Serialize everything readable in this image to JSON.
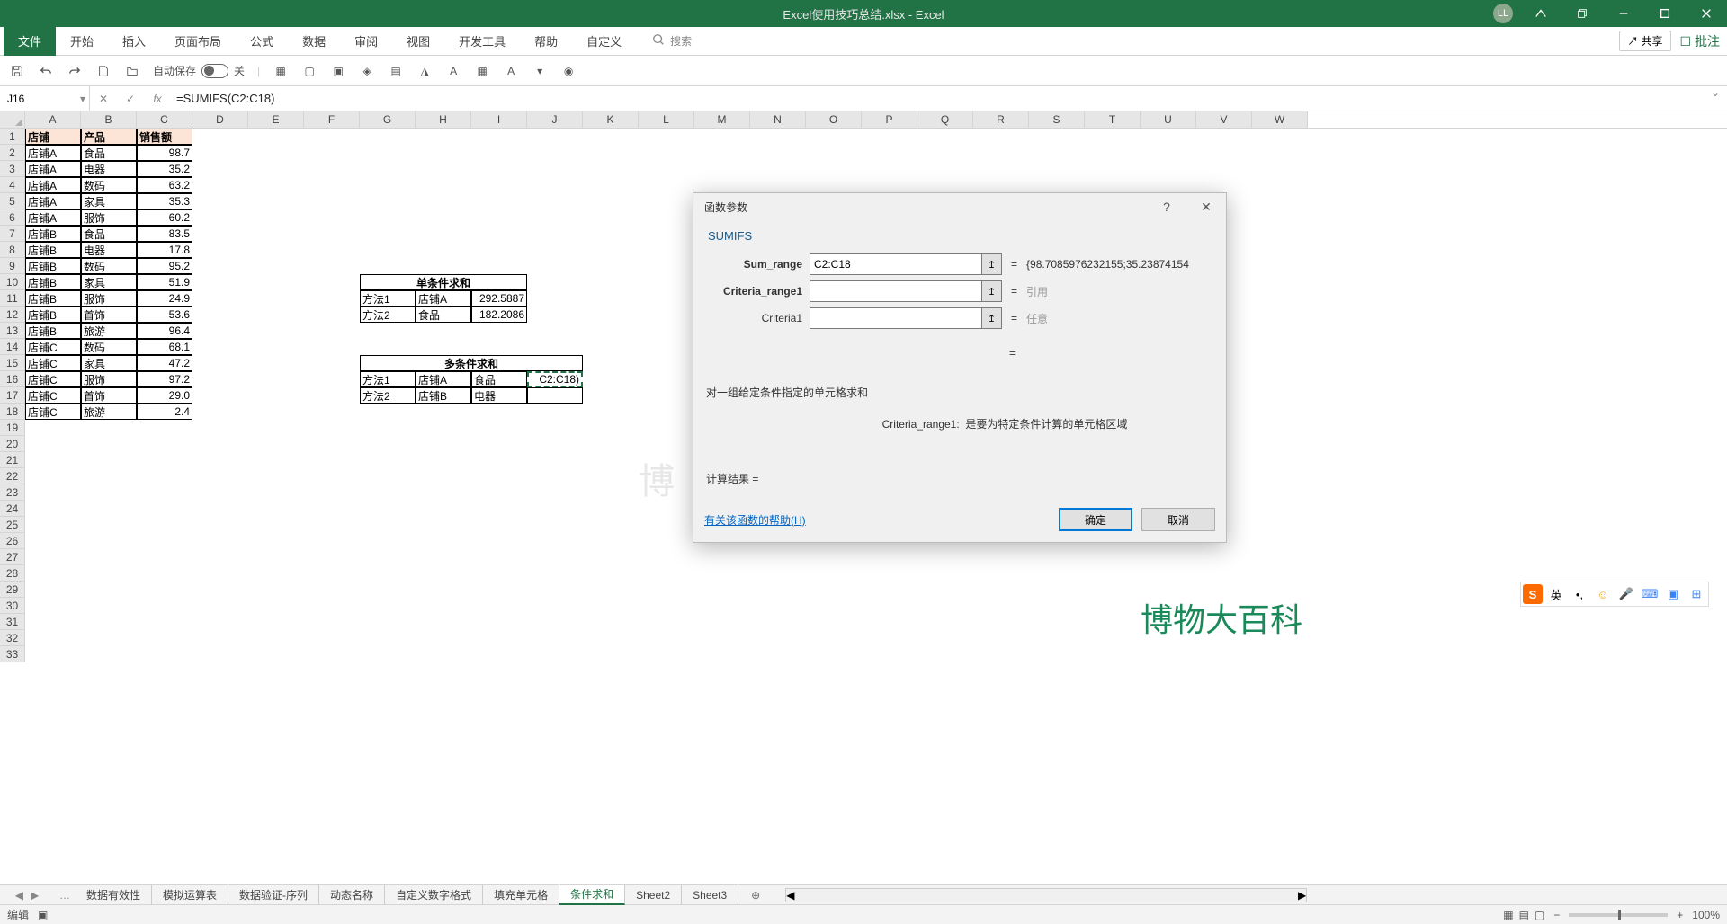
{
  "window": {
    "title": "Excel使用技巧总结.xlsx - Excel",
    "user_initials": "LL"
  },
  "ribbon": {
    "tabs": [
      "文件",
      "开始",
      "插入",
      "页面布局",
      "公式",
      "数据",
      "审阅",
      "视图",
      "开发工具",
      "帮助",
      "自定义"
    ],
    "search_placeholder": "搜索",
    "share": "共享",
    "comments": "批注"
  },
  "qat": {
    "autosave_label": "自动保存",
    "autosave_state": "关"
  },
  "formula_bar": {
    "name_box": "J16",
    "formula": "=SUMIFS(C2:C18)"
  },
  "columns": [
    "A",
    "B",
    "C",
    "D",
    "E",
    "F",
    "G",
    "H",
    "I",
    "J",
    "K",
    "L",
    "M",
    "N",
    "O",
    "P",
    "Q",
    "R",
    "S",
    "T",
    "U",
    "V",
    "W"
  ],
  "table": {
    "headers": [
      "店铺",
      "产品",
      "销售额"
    ],
    "rows": [
      [
        "店铺A",
        "食品",
        "98.7"
      ],
      [
        "店铺A",
        "电器",
        "35.2"
      ],
      [
        "店铺A",
        "数码",
        "63.2"
      ],
      [
        "店铺A",
        "家具",
        "35.3"
      ],
      [
        "店铺A",
        "服饰",
        "60.2"
      ],
      [
        "店铺B",
        "食品",
        "83.5"
      ],
      [
        "店铺B",
        "电器",
        "17.8"
      ],
      [
        "店铺B",
        "数码",
        "95.2"
      ],
      [
        "店铺B",
        "家具",
        "51.9"
      ],
      [
        "店铺B",
        "服饰",
        "24.9"
      ],
      [
        "店铺B",
        "首饰",
        "53.6"
      ],
      [
        "店铺B",
        "旅游",
        "96.4"
      ],
      [
        "店铺C",
        "数码",
        "68.1"
      ],
      [
        "店铺C",
        "家具",
        "47.2"
      ],
      [
        "店铺C",
        "服饰",
        "97.2"
      ],
      [
        "店铺C",
        "首饰",
        "29.0"
      ],
      [
        "店铺C",
        "旅游",
        "2.4"
      ]
    ]
  },
  "block1": {
    "title": "单条件求和",
    "rows": [
      [
        "方法1",
        "店铺A",
        "292.5887"
      ],
      [
        "方法2",
        "食品",
        "182.2086"
      ]
    ]
  },
  "block2": {
    "title": "多条件求和",
    "rows": [
      [
        "方法1",
        "店铺A",
        "食品",
        "C2:C18)"
      ],
      [
        "方法2",
        "店铺B",
        "电器",
        ""
      ]
    ]
  },
  "dialog": {
    "title": "函数参数",
    "func": "SUMIFS",
    "args": [
      {
        "label": "Sum_range",
        "value": "C2:C18",
        "result": "{98.7085976232155;35.23874154",
        "bold": true
      },
      {
        "label": "Criteria_range1",
        "value": "",
        "result": "引用",
        "gray": true,
        "bold": true
      },
      {
        "label": "Criteria1",
        "value": "",
        "result": "任意",
        "gray": true,
        "bold": false
      }
    ],
    "eq_blank": "=",
    "desc": "对一组给定条件指定的单元格求和",
    "arg_desc_label": "Criteria_range1:",
    "arg_desc_text": "是要为特定条件计算的单元格区域",
    "calc_label": "计算结果 =",
    "help": "有关该函数的帮助(H)",
    "ok": "确定",
    "cancel": "取消"
  },
  "sheet_tabs": [
    "数据有效性",
    "模拟运算表",
    "数据验证-序列",
    "动态名称",
    "自定义数字格式",
    "填充单元格",
    "条件求和",
    "Sheet2",
    "Sheet3"
  ],
  "active_sheet": "条件求和",
  "status": {
    "mode": "编辑",
    "zoom": "100%"
  },
  "watermarks": {
    "w1": "博",
    "w2": "博物大百科"
  },
  "ime": {
    "lang": "英"
  }
}
